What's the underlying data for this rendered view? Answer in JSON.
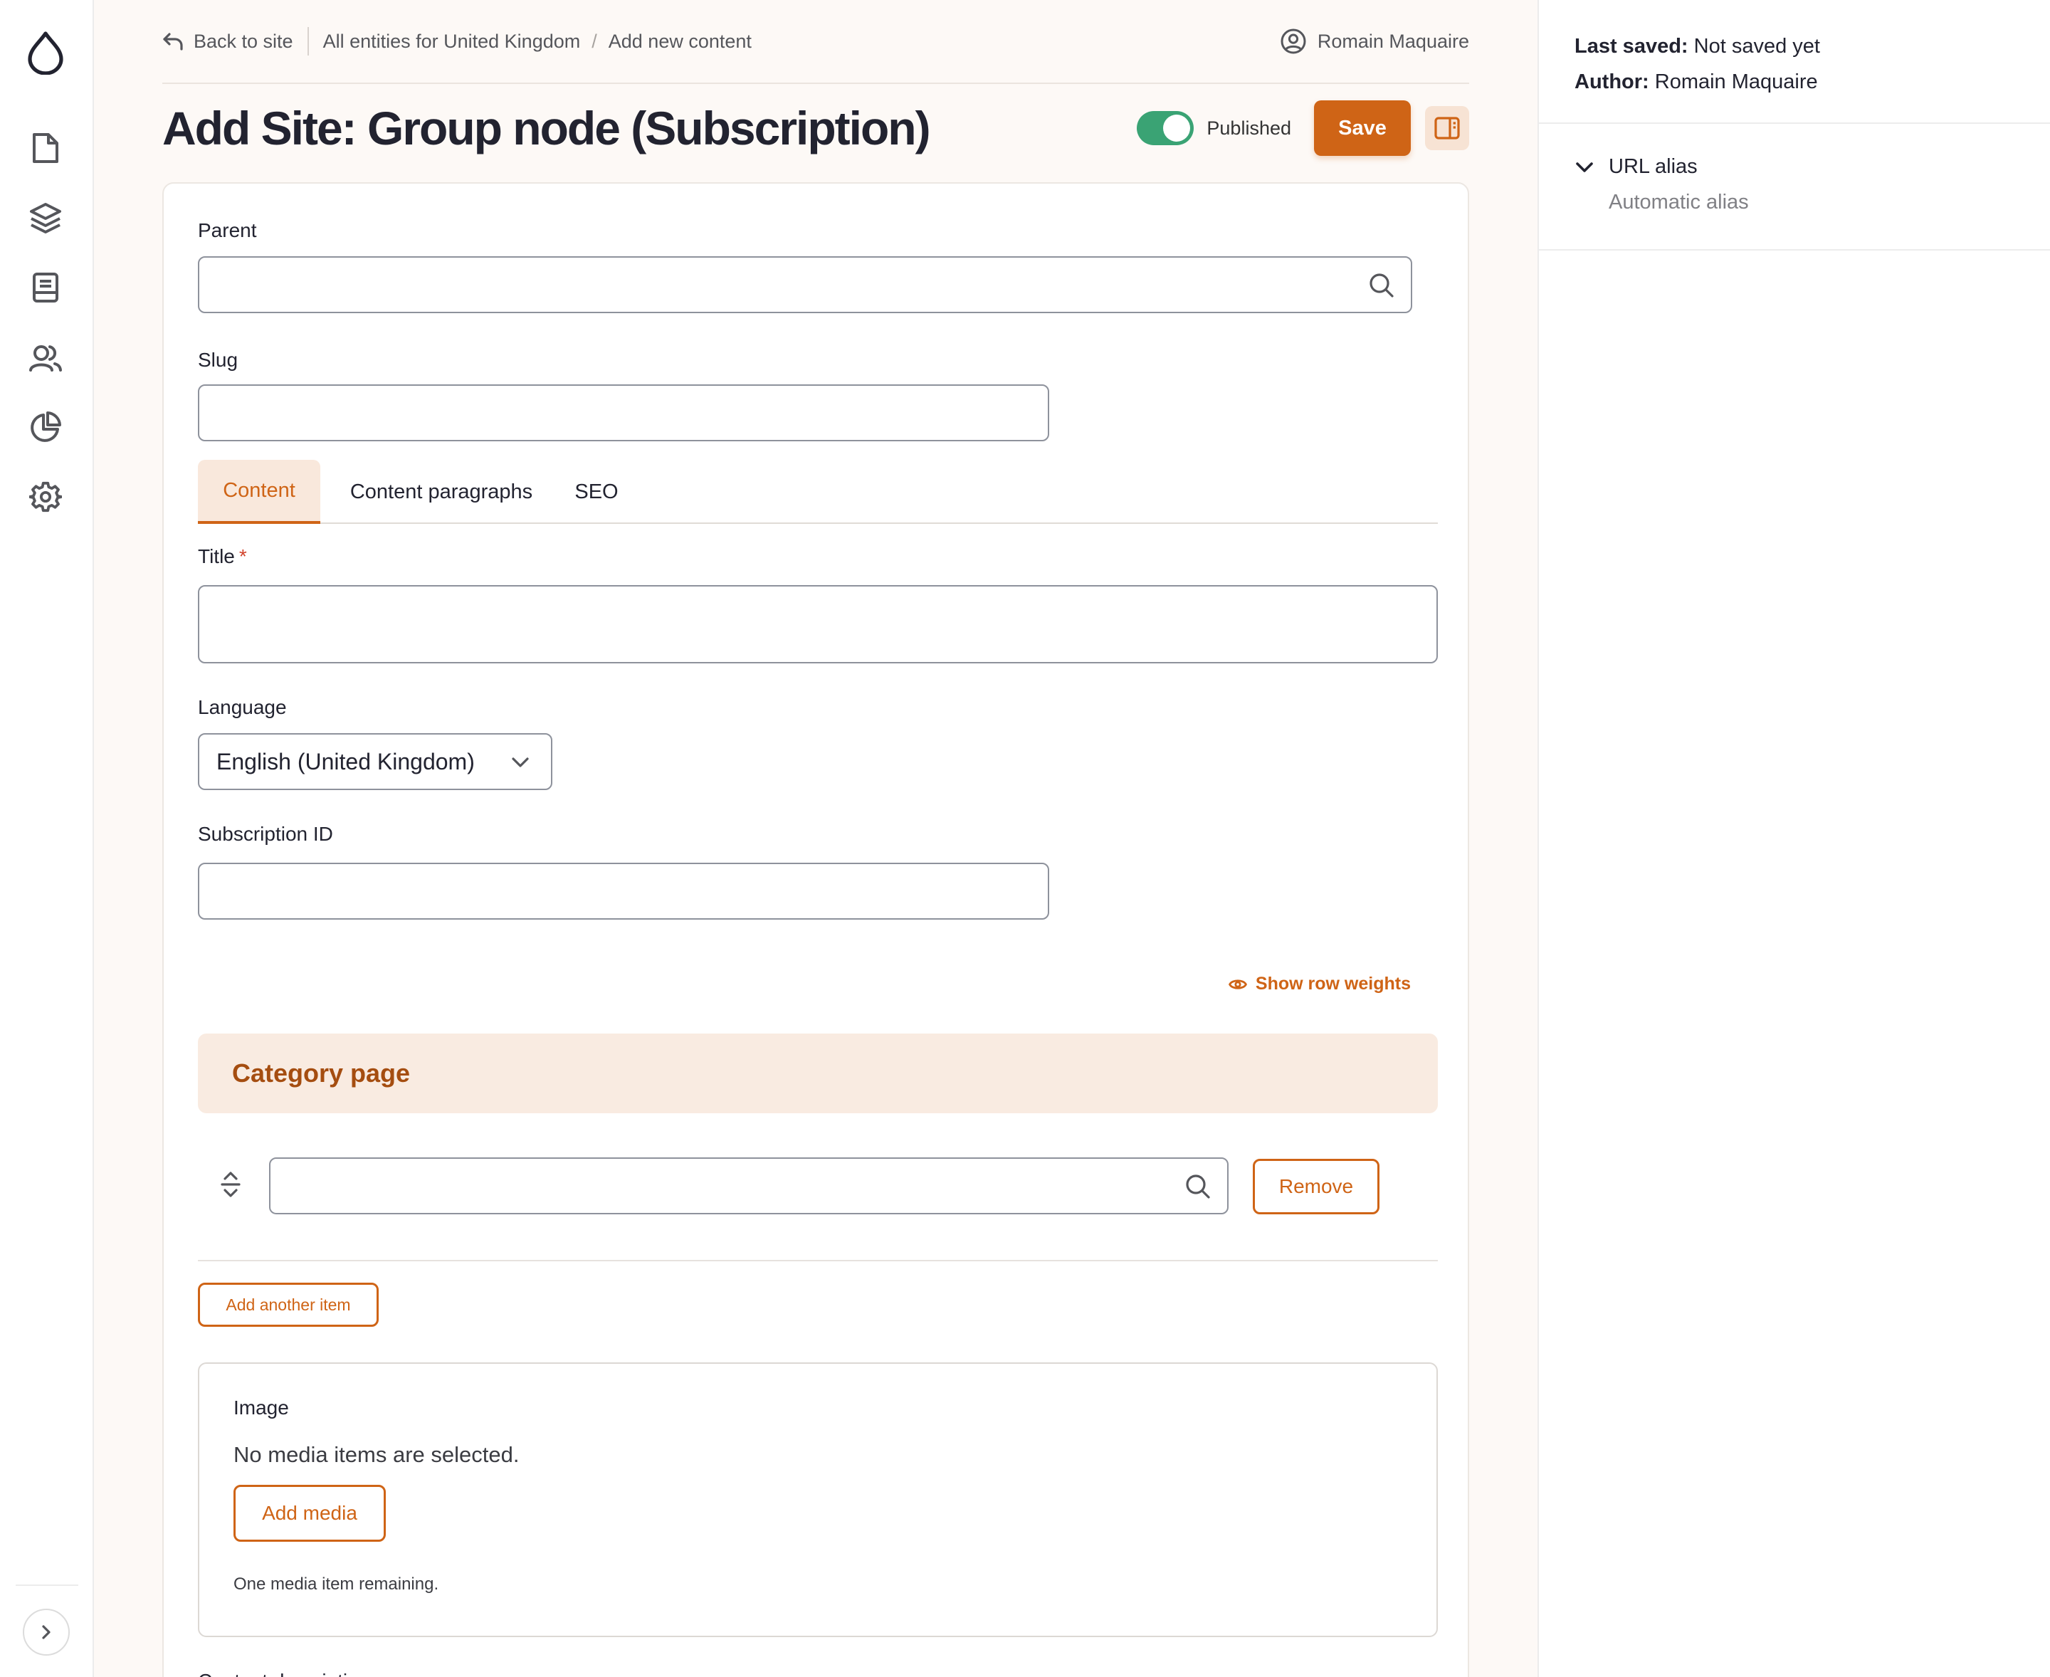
{
  "toolbar": {
    "icons": [
      "drupal-logo-icon",
      "content-icon",
      "structure-icon",
      "book-icon",
      "people-icon",
      "reports-icon",
      "settings-icon"
    ],
    "expand_icon": "chevron-right-icon"
  },
  "topbar": {
    "back_label": "Back to site",
    "breadcrumbs": [
      "All entities for United Kingdom",
      "Add new content"
    ],
    "crumb_separator": "/",
    "user_name": "Romain Maquaire"
  },
  "page": {
    "title": "Add Site: Group node (Subscription)",
    "published_label": "Published",
    "published": true,
    "save_label": "Save"
  },
  "form": {
    "parent": {
      "label": "Parent",
      "value": ""
    },
    "slug": {
      "label": "Slug",
      "value": ""
    },
    "tabs": [
      {
        "label": "Content",
        "active": true
      },
      {
        "label": "Content paragraphs",
        "active": false
      },
      {
        "label": "SEO",
        "active": false
      }
    ],
    "title": {
      "label": "Title",
      "required_mark": "*",
      "value": ""
    },
    "language": {
      "label": "Language",
      "selected": "English (United Kingdom)"
    },
    "subscription_id": {
      "label": "Subscription ID",
      "value": ""
    },
    "show_row_weights": "Show row weights",
    "category_page": {
      "header": "Category page",
      "remove_label": "Remove",
      "add_another_label": "Add another item"
    },
    "image": {
      "label": "Image",
      "empty_text": "No media items are selected.",
      "add_media_label": "Add media",
      "remaining_text": "One media item remaining."
    },
    "next_label": "Content description"
  },
  "sidebar": {
    "last_saved_key": "Last saved:",
    "last_saved_value": "Not saved yet",
    "author_key": "Author:",
    "author_value": "Romain Maquaire",
    "url_alias_label": "URL alias",
    "url_alias_value": "Automatic alias"
  },
  "colors": {
    "accent": "#cf6416",
    "toggle_on": "#3aa374",
    "category_bg": "#f9ebe1",
    "main_bg": "#fdf9f6"
  }
}
